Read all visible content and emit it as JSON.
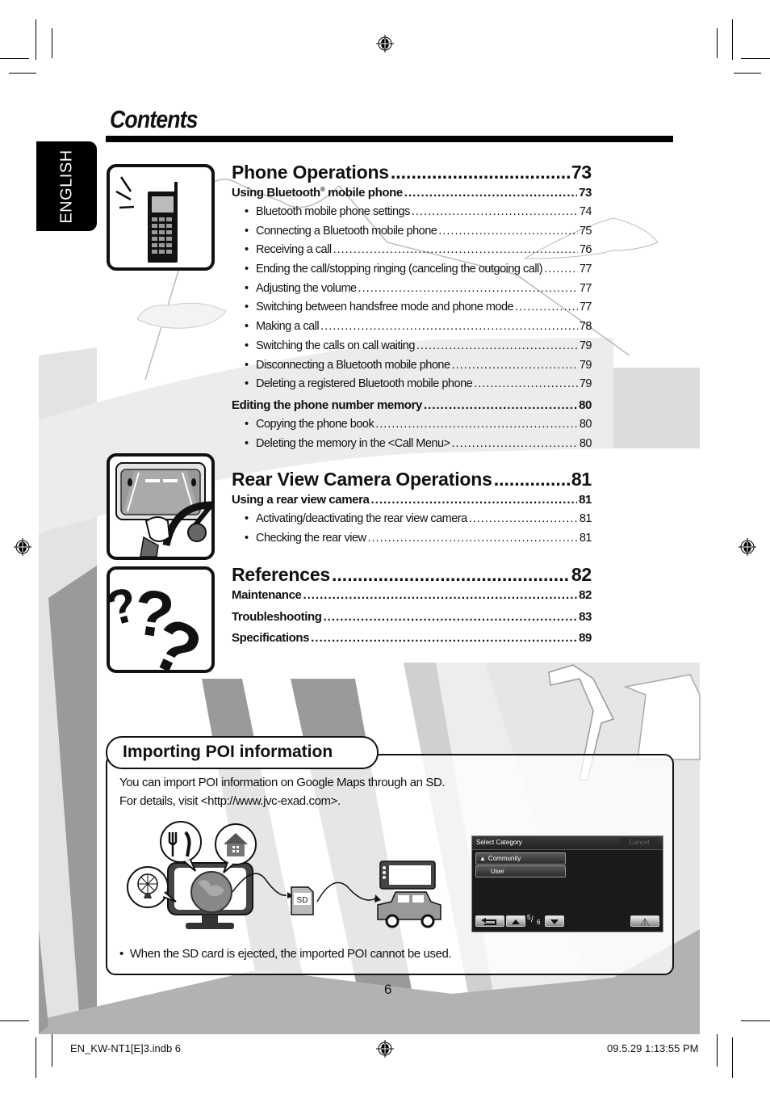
{
  "page": {
    "title": "Contents",
    "language_tab": "ENGLISH",
    "page_number": "6"
  },
  "toc": {
    "phone": {
      "title": "Phone Operations",
      "page": "73",
      "groups": [
        {
          "title": "Using Bluetooth",
          "title_sup": "®",
          "title_rest": " mobile phone",
          "page": "73",
          "items": [
            {
              "label": "Bluetooth mobile phone settings",
              "page": "74"
            },
            {
              "label": "Connecting a Bluetooth mobile phone",
              "page": "75"
            },
            {
              "label": "Receiving a call",
              "page": "76"
            },
            {
              "label": "Ending the call/stopping ringing (canceling the outgoing call)",
              "page": "77"
            },
            {
              "label": "Adjusting the volume",
              "page": "77"
            },
            {
              "label": "Switching between handsfree mode and phone mode",
              "page": "77"
            },
            {
              "label": "Making a call",
              "page": "78"
            },
            {
              "label": "Switching the calls on call waiting",
              "page": "79"
            },
            {
              "label": "Disconnecting a Bluetooth mobile phone",
              "page": "79"
            },
            {
              "label": "Deleting a registered Bluetooth mobile phone",
              "page": "79"
            }
          ]
        },
        {
          "title": "Editing the phone number memory",
          "page": "80",
          "items": [
            {
              "label": "Copying the phone book",
              "page": "80"
            },
            {
              "label": "Deleting the memory in the <Call Menu>",
              "page": "80"
            }
          ]
        }
      ]
    },
    "camera": {
      "title": "Rear View Camera Operations",
      "page": "81",
      "groups": [
        {
          "title": "Using a rear view camera",
          "page": "81",
          "items": [
            {
              "label": "Activating/deactivating the rear view camera",
              "page": "81"
            },
            {
              "label": "Checking the rear view",
              "page": "81"
            }
          ]
        }
      ]
    },
    "references": {
      "title": "References",
      "page": "82",
      "entries": [
        {
          "label": "Maintenance",
          "page": "82"
        },
        {
          "label": "Troubleshooting",
          "page": "83"
        },
        {
          "label": "Specifications",
          "page": "89"
        }
      ]
    }
  },
  "poi": {
    "heading": "Importing POI information",
    "line1": "You can import POI information on Google Maps through an SD.",
    "line2": "For details, visit <http://www.jvc-exad.com>.",
    "note": "When the SD card is ejected, the imported POI cannot be used.",
    "sd_label": "SD",
    "screen": {
      "header": "Select Category",
      "cancel": "Cancel",
      "items": [
        "Community",
        "User"
      ],
      "page_current": "5",
      "page_total": "6"
    }
  },
  "footer": {
    "file": "EN_KW-NT1[E]3.indb   6",
    "timestamp": "09.5.29   1:13:55 PM"
  }
}
